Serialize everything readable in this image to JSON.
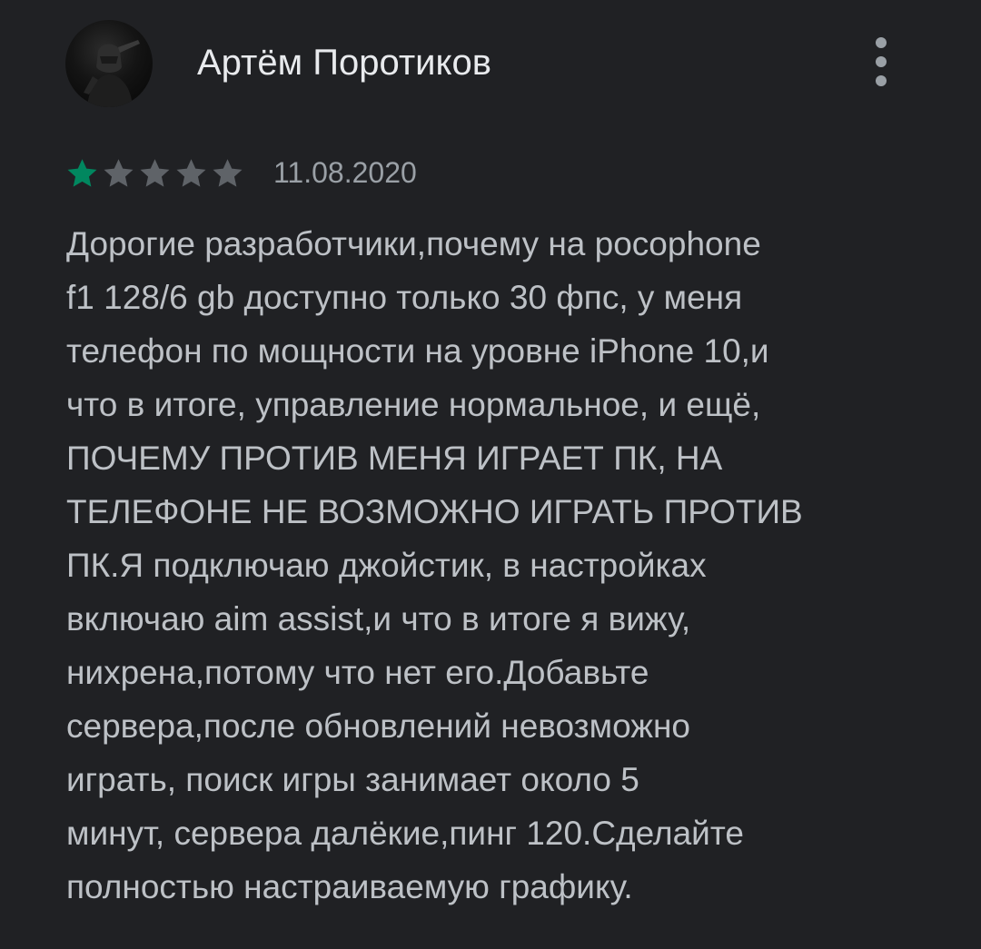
{
  "review": {
    "author_name": "Артём Поротиков",
    "rating": 1,
    "max_rating": 5,
    "date": "11.08.2020",
    "text": "Дорогие разработчики,почему на pocophone\nf1 128/6 gb доступно только 30 фпс, у меня\nтелефон по мощности на уровне iPhone 10,и\nчто в итоге, управление нормальное, и ещё,\nПОЧЕМУ ПРОТИВ МЕНЯ ИГРАЕТ ПК, НА\nТЕЛЕФОНЕ НЕ ВОЗМОЖНО ИГРАТЬ ПРОТИВ\nПК.Я подключаю джойстик, в настройках\nвключаю aim assist,и что в итоге я вижу,\nнихрена,потому что нет его.Добавьте\nсервера,после обновлений невозможно\nиграть, поиск игры занимает около 5\nминут, сервера далёкие,пинг 120.Сделайте\nполностью настраиваемую графику."
  },
  "icons": {
    "avatar": "avatar-photo",
    "more": "more-vertical-icon",
    "star_filled": "star-filled-icon",
    "star_empty": "star-empty-icon"
  },
  "colors": {
    "background": "#202124",
    "author_text": "#e8eaed",
    "body_text": "#bdc1c6",
    "secondary_text": "#9aa0a6",
    "star_filled": "#01875f",
    "star_empty": "#5f6368"
  }
}
